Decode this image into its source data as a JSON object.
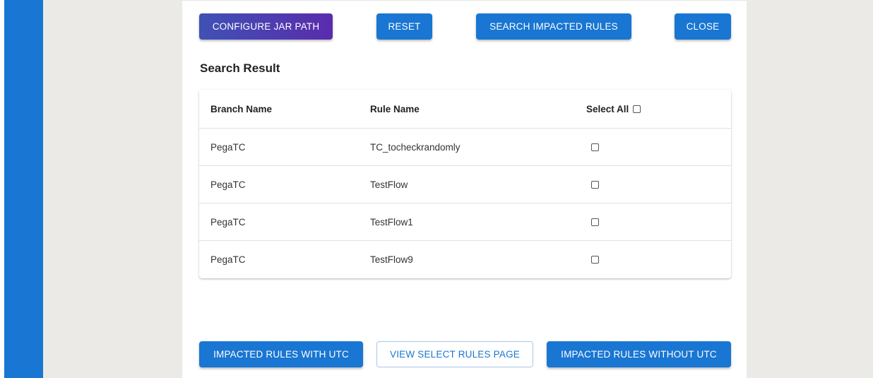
{
  "toolbar": {
    "configure_jar_path": "CONFIGURE JAR PATH",
    "reset": "RESET",
    "search_impacted_rules": "SEARCH IMPACTED RULES",
    "close": "CLOSE"
  },
  "search_result": {
    "title": "Search Result",
    "columns": {
      "branch_name": "Branch Name",
      "rule_name": "Rule Name",
      "select_all": "Select All"
    },
    "rows": [
      {
        "branch": "PegaTC",
        "rule": "TC_tocheckrandomly",
        "selected": false
      },
      {
        "branch": "PegaTC",
        "rule": "TestFlow",
        "selected": false
      },
      {
        "branch": "PegaTC",
        "rule": "TestFlow1",
        "selected": false
      },
      {
        "branch": "PegaTC",
        "rule": "TestFlow9",
        "selected": false
      }
    ]
  },
  "footer": {
    "impacted_with_utc": "IMPACTED RULES WITH UTC",
    "view_select_rules": "VIEW SELECT RULES PAGE",
    "impacted_without_utc": "IMPACTED RULES WITHOUT UTC"
  },
  "colors": {
    "primary": "#1976d2",
    "accent_purple": "#5a2cad",
    "background": "#ebeae6"
  }
}
